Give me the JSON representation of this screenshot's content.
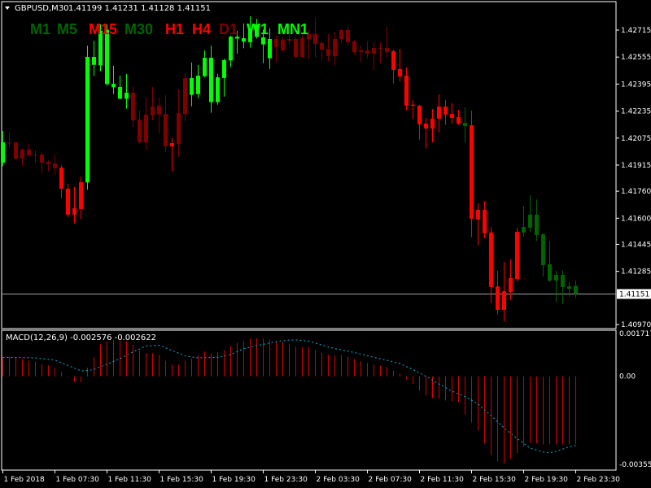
{
  "header": {
    "symbol": "GBPUSD,M30",
    "ohlc": "1.41199 1.41231 1.41128 1.41151"
  },
  "timeframes": [
    {
      "label": "M1",
      "color": "#006400"
    },
    {
      "label": "M5",
      "color": "#006400"
    },
    {
      "label": "M15",
      "color": "#ff0000"
    },
    {
      "label": "M30",
      "color": "#006400"
    },
    {
      "label": "H1",
      "color": "#ff0000"
    },
    {
      "label": "H4",
      "color": "#ff0000"
    },
    {
      "label": "D1",
      "color": "#800000"
    },
    {
      "label": "W1",
      "color": "#00ff00"
    },
    {
      "label": "MN1",
      "color": "#00ff00"
    }
  ],
  "colors": {
    "background": "#000000",
    "frame": "#ffffff",
    "candle_L": "#00ff00",
    "candle_G": "#006400",
    "candle_R": "#ff0000",
    "candle_D": "#800000",
    "macd_histogram": "#d40000",
    "macd_signal": "#00b4e0",
    "price_line": "#a0a0a0"
  },
  "macd_panel": {
    "title": "MACD(12,26,9) -0.002576 -0.002622",
    "axis_labels": [
      "0.001717",
      "0.00",
      "-0.003555"
    ]
  },
  "current_price": "1.41151",
  "chart_data": {
    "type": "candlestick",
    "symbol": "GBPUSD",
    "timeframe": "M30",
    "price_axis_labels": [
      "1.42715",
      "1.42555",
      "1.42395",
      "1.42235",
      "1.42075",
      "1.41915",
      "1.41760",
      "1.41600",
      "1.41445",
      "1.41285",
      "1.40970"
    ],
    "price_range": [
      1.4097,
      1.42715
    ],
    "time_axis_labels": [
      "1 Feb 2018",
      "1 Feb 07:30",
      "1 Feb 11:30",
      "1 Feb 15:30",
      "1 Feb 19:30",
      "1 Feb 23:30",
      "2 Feb 03:30",
      "2 Feb 07:30",
      "2 Feb 11:30",
      "2 Feb 15:30",
      "2 Feb 19:30",
      "2 Feb 23:30"
    ],
    "candles_format": [
      "open",
      "high",
      "low",
      "close",
      "color"
    ],
    "candles": [
      [
        1.41929,
        1.42117,
        1.41908,
        1.4205,
        "L"
      ],
      [
        1.42048,
        1.42112,
        1.42022,
        1.42045,
        "D"
      ],
      [
        1.4205,
        1.4205,
        1.41942,
        1.41953,
        "D"
      ],
      [
        1.42006,
        1.42014,
        1.4191,
        1.41953,
        "D"
      ],
      [
        1.42006,
        1.4204,
        1.41965,
        1.41973,
        "D"
      ],
      [
        1.41977,
        1.42002,
        1.41929,
        1.41974,
        "D"
      ],
      [
        1.41977,
        1.4199,
        1.41868,
        1.41929,
        "D"
      ],
      [
        1.41934,
        1.41942,
        1.41878,
        1.41921,
        "D"
      ],
      [
        1.41924,
        1.41973,
        1.41857,
        1.41897,
        "D"
      ],
      [
        1.419,
        1.41915,
        1.41719,
        1.41775,
        "R"
      ],
      [
        1.41775,
        1.41804,
        1.41606,
        1.41621,
        "R"
      ],
      [
        1.41659,
        1.41785,
        1.41569,
        1.41621,
        "R"
      ],
      [
        1.41814,
        1.41847,
        1.41593,
        1.41654,
        "R"
      ],
      [
        1.41812,
        1.42623,
        1.41769,
        1.42556,
        "L"
      ],
      [
        1.42509,
        1.42652,
        1.42443,
        1.42556,
        "L"
      ],
      [
        1.42506,
        1.42749,
        1.42471,
        1.4271,
        "L"
      ],
      [
        1.42395,
        1.42749,
        1.42384,
        1.42717,
        "L"
      ],
      [
        1.42376,
        1.42503,
        1.42336,
        1.42397,
        "L"
      ],
      [
        1.42308,
        1.42445,
        1.42305,
        1.42378,
        "L"
      ],
      [
        1.42308,
        1.42455,
        1.42249,
        1.42344,
        "L"
      ],
      [
        1.42344,
        1.42382,
        1.42141,
        1.4218,
        "D"
      ],
      [
        1.42185,
        1.42238,
        1.42042,
        1.4205,
        "D"
      ],
      [
        1.42214,
        1.42315,
        1.42006,
        1.4205,
        "D"
      ],
      [
        1.42262,
        1.42378,
        1.4218,
        1.42209,
        "D"
      ],
      [
        1.42267,
        1.42315,
        1.42103,
        1.42214,
        "D"
      ],
      [
        1.42218,
        1.42329,
        1.41993,
        1.42026,
        "D"
      ],
      [
        1.42045,
        1.42074,
        1.41878,
        1.42026,
        "R"
      ],
      [
        1.42223,
        1.42363,
        1.41963,
        1.4204,
        "D"
      ],
      [
        1.42431,
        1.4246,
        1.42175,
        1.42218,
        "D"
      ],
      [
        1.42331,
        1.42522,
        1.42263,
        1.42431,
        "L"
      ],
      [
        1.42336,
        1.42508,
        1.42312,
        1.42445,
        "L"
      ],
      [
        1.42442,
        1.42595,
        1.42435,
        1.42551,
        "L"
      ],
      [
        1.42288,
        1.42623,
        1.42225,
        1.42551,
        "L"
      ],
      [
        1.42288,
        1.42455,
        1.42273,
        1.42435,
        "L"
      ],
      [
        1.42431,
        1.42546,
        1.42321,
        1.42537,
        "L"
      ],
      [
        1.42535,
        1.42681,
        1.42495,
        1.42676,
        "L"
      ],
      [
        1.42665,
        1.4271,
        1.42575,
        1.42676,
        "L"
      ],
      [
        1.42646,
        1.42754,
        1.42607,
        1.42667,
        "L"
      ],
      [
        1.42643,
        1.42797,
        1.42611,
        1.42725,
        "L"
      ],
      [
        1.42675,
        1.42781,
        1.42665,
        1.42749,
        "L"
      ],
      [
        1.4263,
        1.42717,
        1.42519,
        1.42672,
        "L"
      ],
      [
        1.42548,
        1.42725,
        1.42485,
        1.42662,
        "L"
      ],
      [
        1.42662,
        1.42681,
        1.42524,
        1.42615,
        "D"
      ],
      [
        1.42657,
        1.42673,
        1.42591,
        1.42595,
        "D"
      ],
      [
        1.42662,
        1.42688,
        1.42628,
        1.42652,
        "D"
      ],
      [
        1.42662,
        1.42668,
        1.42543,
        1.42556,
        "D"
      ],
      [
        1.42667,
        1.42685,
        1.42551,
        1.42556,
        "D"
      ],
      [
        1.42691,
        1.42717,
        1.42543,
        1.42662,
        "D"
      ],
      [
        1.42691,
        1.42789,
        1.42553,
        1.42633,
        "D"
      ],
      [
        1.42638,
        1.42648,
        1.42532,
        1.42599,
        "D"
      ],
      [
        1.42604,
        1.42691,
        1.42529,
        1.42561,
        "D"
      ],
      [
        1.42662,
        1.42705,
        1.42505,
        1.42561,
        "D"
      ],
      [
        1.42715,
        1.42725,
        1.42643,
        1.42662,
        "D"
      ],
      [
        1.42715,
        1.4273,
        1.42628,
        1.42643,
        "D"
      ],
      [
        1.42648,
        1.42657,
        1.42572,
        1.42585,
        "D"
      ],
      [
        1.42595,
        1.42623,
        1.42529,
        1.42585,
        "D"
      ],
      [
        1.42595,
        1.42648,
        1.42548,
        1.42575,
        "D"
      ],
      [
        1.42609,
        1.42648,
        1.42476,
        1.42575,
        "D"
      ],
      [
        1.42609,
        1.42643,
        1.42519,
        1.42604,
        "D"
      ],
      [
        1.42609,
        1.42734,
        1.42553,
        1.42585,
        "D"
      ],
      [
        1.4259,
        1.42599,
        1.42398,
        1.42479,
        "R"
      ],
      [
        1.42484,
        1.42604,
        1.42411,
        1.4244,
        "R"
      ],
      [
        1.42445,
        1.42493,
        1.42239,
        1.42267,
        "R"
      ],
      [
        1.42273,
        1.423,
        1.42186,
        1.42267,
        "R"
      ],
      [
        1.42267,
        1.42272,
        1.42066,
        1.42156,
        "R"
      ],
      [
        1.42161,
        1.42194,
        1.42013,
        1.42132,
        "R"
      ],
      [
        1.4219,
        1.42247,
        1.42051,
        1.42132,
        "R"
      ],
      [
        1.42262,
        1.42334,
        1.42109,
        1.4219,
        "R"
      ],
      [
        1.42262,
        1.423,
        1.42153,
        1.42214,
        "R"
      ],
      [
        1.42218,
        1.42281,
        1.42162,
        1.42194,
        "R"
      ],
      [
        1.42199,
        1.42243,
        1.42153,
        1.42161,
        "R"
      ],
      [
        1.42146,
        1.42257,
        1.4205,
        1.42165,
        "G"
      ],
      [
        1.42151,
        1.42238,
        1.41487,
        1.41597,
        "R"
      ],
      [
        1.4165,
        1.41688,
        1.41439,
        1.41592,
        "R"
      ],
      [
        1.4165,
        1.41703,
        1.41482,
        1.4151,
        "R"
      ],
      [
        1.41515,
        1.41548,
        1.41097,
        1.41192,
        "R"
      ],
      [
        1.41196,
        1.41288,
        1.41029,
        1.41057,
        "R"
      ],
      [
        1.41167,
        1.41341,
        1.40986,
        1.41057,
        "R"
      ],
      [
        1.41245,
        1.41356,
        1.41116,
        1.41163,
        "R"
      ],
      [
        1.41519,
        1.41544,
        1.41225,
        1.4124,
        "R"
      ],
      [
        1.41515,
        1.41674,
        1.41492,
        1.41548,
        "G"
      ],
      [
        1.41544,
        1.41736,
        1.41519,
        1.41621,
        "G"
      ],
      [
        1.415,
        1.41712,
        1.41466,
        1.41621,
        "G"
      ],
      [
        1.41322,
        1.41511,
        1.41254,
        1.41505,
        "G"
      ],
      [
        1.4123,
        1.41466,
        1.41221,
        1.41327,
        "G"
      ],
      [
        1.4123,
        1.41288,
        1.41105,
        1.41264,
        "G"
      ],
      [
        1.41192,
        1.41293,
        1.41092,
        1.41264,
        "G"
      ],
      [
        1.41182,
        1.41221,
        1.41135,
        1.41196,
        "G"
      ],
      [
        1.41199,
        1.41231,
        1.41128,
        1.41151,
        "G"
      ]
    ],
    "macd": {
      "params": "12,26,9",
      "range": [
        -0.003555,
        0.001717
      ],
      "histogram": [
        0.00072,
        0.00074,
        0.000699,
        0.000658,
        0.000596,
        0.000565,
        0.000473,
        0.000411,
        0.000329,
        0.000164,
        2.1e-05,
        -0.000226,
        -0.000226,
        0.000329,
        0.00072,
        0.001213,
        0.001316,
        0.001388,
        0.001357,
        0.001336,
        0.001192,
        0.000977,
        0.000874,
        0.000874,
        0.000822,
        0.000596,
        0.000442,
        0.000442,
        0.000596,
        0.000668,
        0.000792,
        0.000946,
        0.000864,
        0.000915,
        0.000997,
        0.001151,
        0.001275,
        0.001347,
        0.001439,
        0.001439,
        0.001439,
        0.001398,
        0.001336,
        0.001306,
        0.001234,
        0.001121,
        0.00111,
        0.00111,
        0.000997,
        0.000894,
        0.000812,
        0.000781,
        0.000812,
        0.00075,
        0.000658,
        0.000565,
        0.000504,
        0.000442,
        0.000411,
        0.00035,
        0.000226,
        0.000103,
        -0.000113,
        -0.000298,
        -0.000545,
        -0.00073,
        -0.000822,
        -0.000853,
        -0.000915,
        -0.000946,
        -0.000977,
        -0.001439,
        -0.001748,
        -0.002056,
        -0.002549,
        -0.002981,
        -0.003228,
        -0.00332,
        -0.003135,
        -0.00292,
        -0.002673,
        -0.002519,
        -0.002549,
        -0.00258,
        -0.00258,
        -0.00258,
        -0.00258,
        -0.00258,
        -0.002576
      ],
      "signal": [
        0.00072,
        0.000716,
        0.000712,
        0.000708,
        0.000703,
        0.000699,
        0.000672,
        0.000644,
        0.000617,
        0.000514,
        0.000411,
        0.000309,
        0.000206,
        0.000219,
        0.000257,
        0.000365,
        0.000462,
        0.000565,
        0.000668,
        0.000797,
        0.000925,
        0.001038,
        0.00115,
        0.001165,
        0.00118,
        0.001079,
        0.000977,
        0.000874,
        0.000771,
        0.000735,
        0.000699,
        0.000706,
        0.000713,
        0.00072,
        0.000771,
        0.000822,
        0.000936,
        0.001049,
        0.001104,
        0.001158,
        0.001213,
        0.001265,
        0.001316,
        0.001345,
        0.001374,
        0.001378,
        0.001357,
        0.001336,
        0.001259,
        0.001182,
        0.001116,
        0.001049,
        0.001003,
        0.000956,
        0.0009,
        0.000843,
        0.000782,
        0.00072,
        0.000664,
        0.000607,
        0.000545,
        0.000483,
        0.00037,
        0.000257,
        0.000129,
        0.0,
        -0.000144,
        -0.000288,
        -0.000427,
        -0.000565,
        -0.000668,
        -0.000771,
        -0.00091,
        -0.001049,
        -0.00127,
        -0.001491,
        -0.001722,
        -0.001953,
        -0.002159,
        -0.002364,
        -0.002544,
        -0.002724,
        -0.002796,
        -0.002868,
        -0.002899,
        -0.002848,
        -0.00276,
        -0.002673,
        -0.002622
      ]
    }
  }
}
